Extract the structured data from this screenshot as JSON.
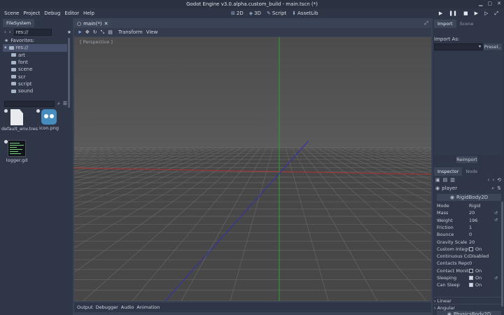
{
  "window": {
    "title": "Godot Engine v3.0.alpha.custom_build - main.tscn (*)"
  },
  "menu": [
    "Scene",
    "Project",
    "Debug",
    "Editor",
    "Help"
  ],
  "workspaces": [
    {
      "label": "2D",
      "icon": "2d-icon"
    },
    {
      "label": "3D",
      "icon": "3d-icon"
    },
    {
      "label": "Script",
      "icon": "script-icon"
    },
    {
      "label": "AssetLib",
      "icon": "assetlib-icon"
    }
  ],
  "filesystem": {
    "tab": "FileSystem",
    "path": "res://",
    "tree": {
      "favorites": "Favorites:",
      "root": "res://",
      "folders": [
        "art",
        "font",
        "scene",
        "scr",
        "script",
        "sound"
      ]
    },
    "files": [
      {
        "name": "default_env.tres",
        "kind": "resource"
      },
      {
        "name": "icon.png",
        "kind": "image"
      },
      {
        "name": "logger.gd",
        "kind": "script"
      }
    ]
  },
  "editor": {
    "scene_tab": "main(*)",
    "toolbar": {
      "transform": "Transform",
      "view": "View"
    },
    "viewport_label": "[ Perspective ]",
    "bottom_tabs": [
      "Output",
      "Debugger",
      "Audio",
      "Animation"
    ]
  },
  "import_dock": {
    "tabs": [
      "Import",
      "Scene"
    ],
    "import_as": "Import As:",
    "preset": "Preset..",
    "reimport": "Reimport"
  },
  "inspector": {
    "tabs": [
      "Inspector",
      "Node"
    ],
    "object": "player",
    "class": "RigidBody2D",
    "properties": [
      {
        "name": "Mode",
        "value": "Rigid"
      },
      {
        "name": "Mass",
        "value": "20"
      },
      {
        "name": "Weight",
        "value": "196"
      },
      {
        "name": "Friction",
        "value": "1"
      },
      {
        "name": "Bounce",
        "value": "0"
      },
      {
        "name": "Gravity Scale",
        "value": "20"
      },
      {
        "name": "Custom Integrat",
        "value": "On",
        "checkbox": true,
        "checked": false
      },
      {
        "name": "Continuous Cd",
        "value": "Disabled"
      },
      {
        "name": "Contacts Report",
        "value": "0"
      },
      {
        "name": "Contact Monitor",
        "value": "On",
        "checkbox": true,
        "checked": false
      },
      {
        "name": "Sleeping",
        "value": "On",
        "checkbox": true,
        "checked": true
      },
      {
        "name": "Can Sleep",
        "value": "On",
        "checkbox": true,
        "checked": true
      }
    ],
    "sections": [
      "Linear",
      "Angular"
    ],
    "parent_class": "PhysicsBody2D"
  },
  "colors": {
    "accent": "#8fb3ff",
    "viewport": "#4b4b4b",
    "x_axis": "#b03030",
    "y_axis": "#30a030",
    "z_axis": "#3030b0"
  }
}
